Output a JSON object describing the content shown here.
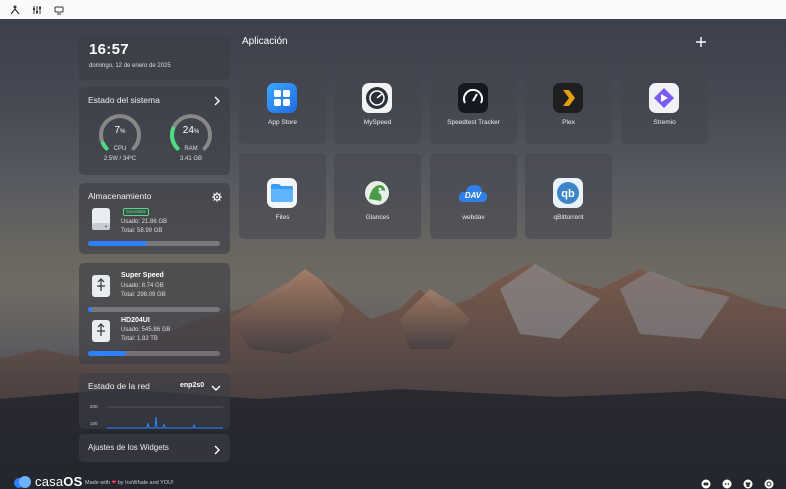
{
  "topbar": {
    "icons": [
      "apps-grid-icon",
      "sliders-icon",
      "monitor-icon"
    ]
  },
  "clock": {
    "time": "16:57",
    "date": "domingo, 12 de enero de 2025"
  },
  "system": {
    "title": "Estado del sistema",
    "cpu": {
      "value": "7",
      "unit": "%",
      "label": "CPU",
      "sub": "2.5W / 34ºC",
      "fraction": 0.07
    },
    "ram": {
      "value": "24",
      "unit": "%",
      "label": "RAM",
      "sub": "3.41 GB",
      "fraction": 0.24
    }
  },
  "storage": {
    "title": "Almacenamiento",
    "status": "Saludable",
    "used": "Usado: 21.86 GB",
    "total": "Total: 58.99 GB",
    "fraction": 0.45
  },
  "usb": [
    {
      "name": "Super Speed",
      "used": "Usado: 8.74 GB",
      "total": "Total: 298.09 GB",
      "fraction": 0.03
    },
    {
      "name": "HD204UI",
      "used": "Usado: 545.86 GB",
      "total": "Total: 1.82 TB",
      "fraction": 0.29
    }
  ],
  "network": {
    "title": "Estado de la red",
    "iface": "enp2s0",
    "y_max": "200",
    "y_mid": "100"
  },
  "widgets": {
    "label": "Ajustes de los Widgets"
  },
  "apps": {
    "title": "Aplicación",
    "items": [
      {
        "name": "App Store",
        "icon": "app-store-icon"
      },
      {
        "name": "MySpeed",
        "icon": "myspeed-icon"
      },
      {
        "name": "Speedtest Tracker",
        "icon": "speedtest-icon"
      },
      {
        "name": "Plex",
        "icon": "plex-icon"
      },
      {
        "name": "Stremio",
        "icon": "stremio-icon"
      },
      {
        "name": "Files",
        "icon": "files-icon"
      },
      {
        "name": "Glances",
        "icon": "glances-icon"
      },
      {
        "name": "webdav",
        "icon": "webdav-icon"
      },
      {
        "name": "qBittorrent",
        "icon": "qbittorrent-icon"
      }
    ]
  },
  "footer": {
    "brand_a": "casa",
    "brand_b": "OS",
    "made_prefix": "Made with",
    "made_suffix": "by IceWhale and YOU!",
    "icons": [
      "forum-icon",
      "discord-icon",
      "github-icon",
      "help-icon"
    ]
  },
  "colors": {
    "gauge": "#4ade80",
    "bar": "#2f80ff",
    "accent": "#2f80ff"
  }
}
